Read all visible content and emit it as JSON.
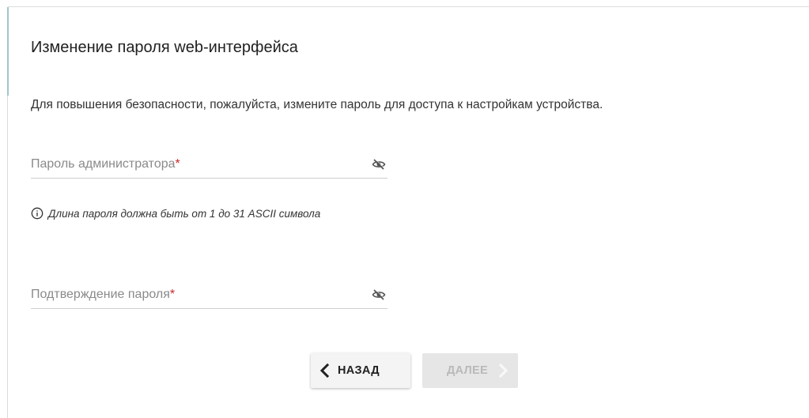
{
  "page": {
    "title": "Изменение пароля web-интерфейса",
    "description": "Для повышения безопасности, пожалуйста, измените пароль для доступа к настройкам устройства."
  },
  "fields": {
    "admin_password": {
      "label": "Пароль администратора",
      "required_mark": "*",
      "value": "",
      "icon": "eye-off-icon"
    },
    "confirm_password": {
      "label": "Подтверждение пароля",
      "required_mark": "*",
      "value": "",
      "icon": "eye-off-icon"
    }
  },
  "hint": {
    "icon": "info-icon",
    "text": "Длина пароля должна быть от 1 до 31 ASCII символа"
  },
  "buttons": {
    "back": {
      "label": "НАЗАД",
      "icon": "chevron-left-icon"
    },
    "next": {
      "label": "ДАЛЕЕ",
      "icon": "chevron-right-icon",
      "disabled": true
    }
  },
  "colors": {
    "accent_border": "#9fc6cf",
    "required": "#c62828",
    "text": "#212121",
    "placeholder": "#8a8a8a",
    "disabled_text": "#b9b9b9",
    "disabled_bg": "#e6e6e6"
  }
}
